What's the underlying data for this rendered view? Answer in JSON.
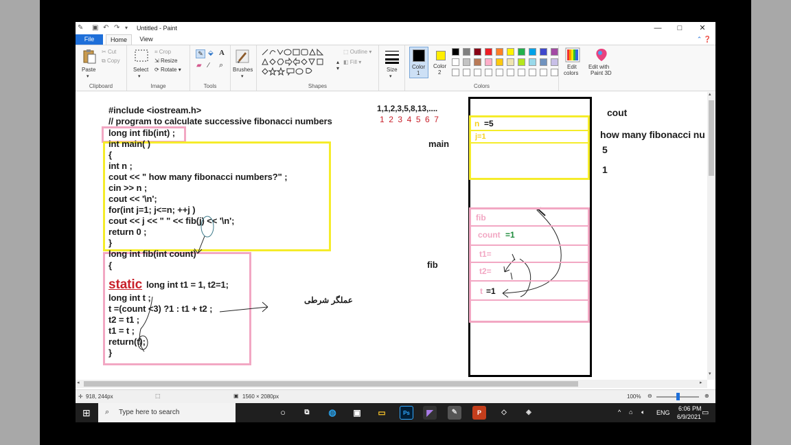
{
  "window": {
    "title": "Untitled - Paint",
    "controls": {
      "minimize": "—",
      "maximize": "□",
      "close": "✕"
    }
  },
  "tabs": {
    "file": "File",
    "home": "Home",
    "view": "View"
  },
  "ribbon": {
    "clipboard": {
      "group": "Clipboard",
      "paste": "Paste",
      "cut": "Cut",
      "copy": "Copy"
    },
    "image": {
      "group": "Image",
      "select": "Select",
      "crop": "Crop",
      "resize": "Resize",
      "rotate": "Rotate"
    },
    "tools": {
      "group": "Tools"
    },
    "brushes": "Brushes",
    "shapes": {
      "group": "Shapes",
      "outline": "Outline",
      "fill": "Fill"
    },
    "size": "Size",
    "colors": {
      "group": "Colors",
      "color1_line1": "Color",
      "color1_line2": "1",
      "color2_line1": "Color",
      "color2_line2": "2",
      "edit_line1": "Edit",
      "edit_line2": "colors",
      "paint3d_line1": "Edit with",
      "paint3d_line2": "Paint 3D",
      "color1_value": "#000000",
      "color2_value": "#ffee00",
      "palette_row1": [
        "#000000",
        "#7f7f7f",
        "#880015",
        "#ed1c24",
        "#ff7f27",
        "#fff200",
        "#22b14c",
        "#00a2e8",
        "#3f48cc",
        "#a349a4"
      ],
      "palette_row2": [
        "#ffffff",
        "#c3c3c3",
        "#b97a57",
        "#ffaec9",
        "#ffc90e",
        "#efe4b0",
        "#b5e61d",
        "#99d9ea",
        "#7092be",
        "#c8bfe7"
      ]
    }
  },
  "canvas": {
    "code_lines": [
      "#include    <iostream.h>",
      "// program to calculate successive fibonacci numbers",
      "long int fib(int) ;",
      "int main( )",
      "{",
      "int n ;",
      "cout << \" how many fibonacci numbers?\" ;",
      "cin >> n ;",
      "cout << '\\n';",
      "for(int j=1; j<=n; ++j )",
      "cout << j << \"   \" << fib(j) << '\\n';",
      "return 0 ;",
      "}"
    ],
    "fib_lines": [
      "long int fib(int count)",
      "{"
    ],
    "static_word": "static",
    "static_rest": " long int t1 = 1, t2=1;",
    "fib_lines_after": [
      "long int  t ;",
      "t =(count <3) ?1 : t1 + t2 ;",
      "t2 = t1 ;",
      "t1 = t ;",
      "return(t);",
      "}"
    ],
    "arabic_note": "عملگر شرطی",
    "sequence": "1,1,2,3,5,8,13,....",
    "sequence_index": "1 2 3 4 5 6 7",
    "main_label": "main",
    "fib_label": "fib",
    "stack": {
      "n_label": "n",
      "n_value": "=5",
      "j_label": "j=1",
      "fib_label": "fib",
      "count_label": "count",
      "count_value": "=1",
      "t1_label": "t1=",
      "t2_label": "t2=",
      "t_label": "t",
      "t_value": "=1"
    },
    "cout_label": "cout",
    "cout_text": "how many fibonacci nu",
    "cout_values": [
      "5",
      "1"
    ]
  },
  "status": {
    "cursor_pos": "918, 244px",
    "image_size": "1560 × 2080px",
    "zoom": "100%"
  },
  "taskbar": {
    "search_placeholder": "Type here to search",
    "lang": "ENG",
    "time": "6:06 PM",
    "date": "6/9/2021"
  }
}
